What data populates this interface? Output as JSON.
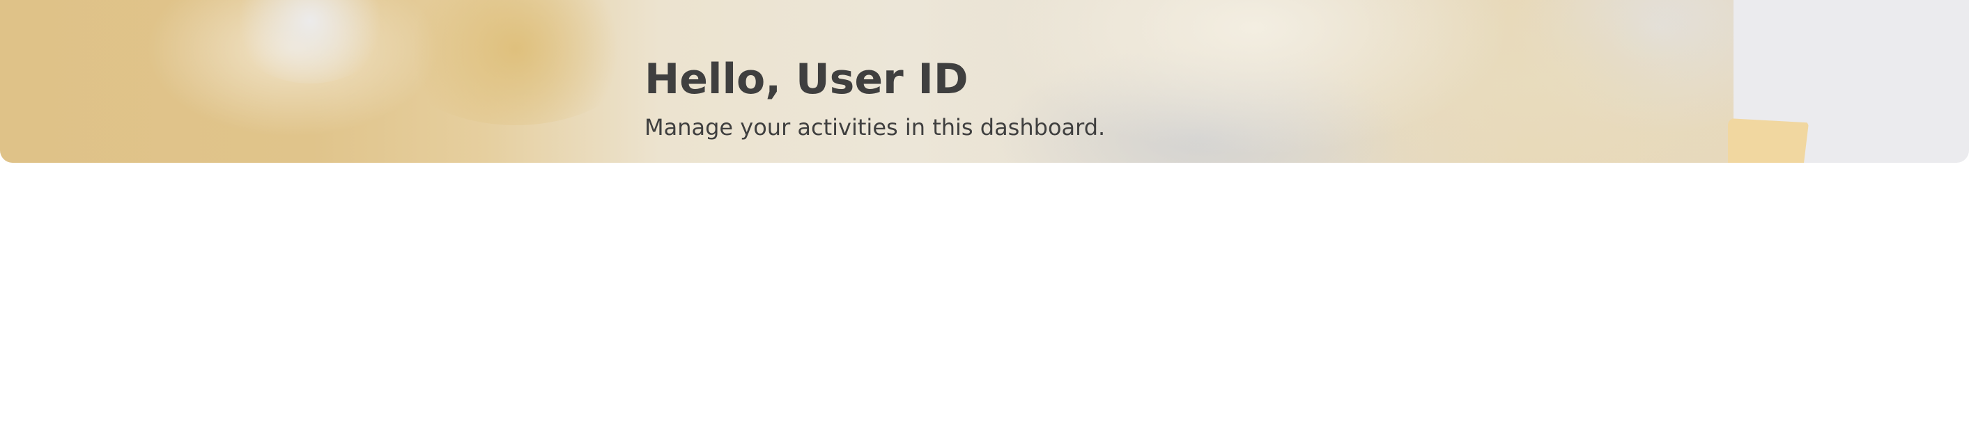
{
  "dashboard_header": {
    "greeting": "Hello, User ID",
    "subtitle": "Manage your activities in this dashboard."
  }
}
